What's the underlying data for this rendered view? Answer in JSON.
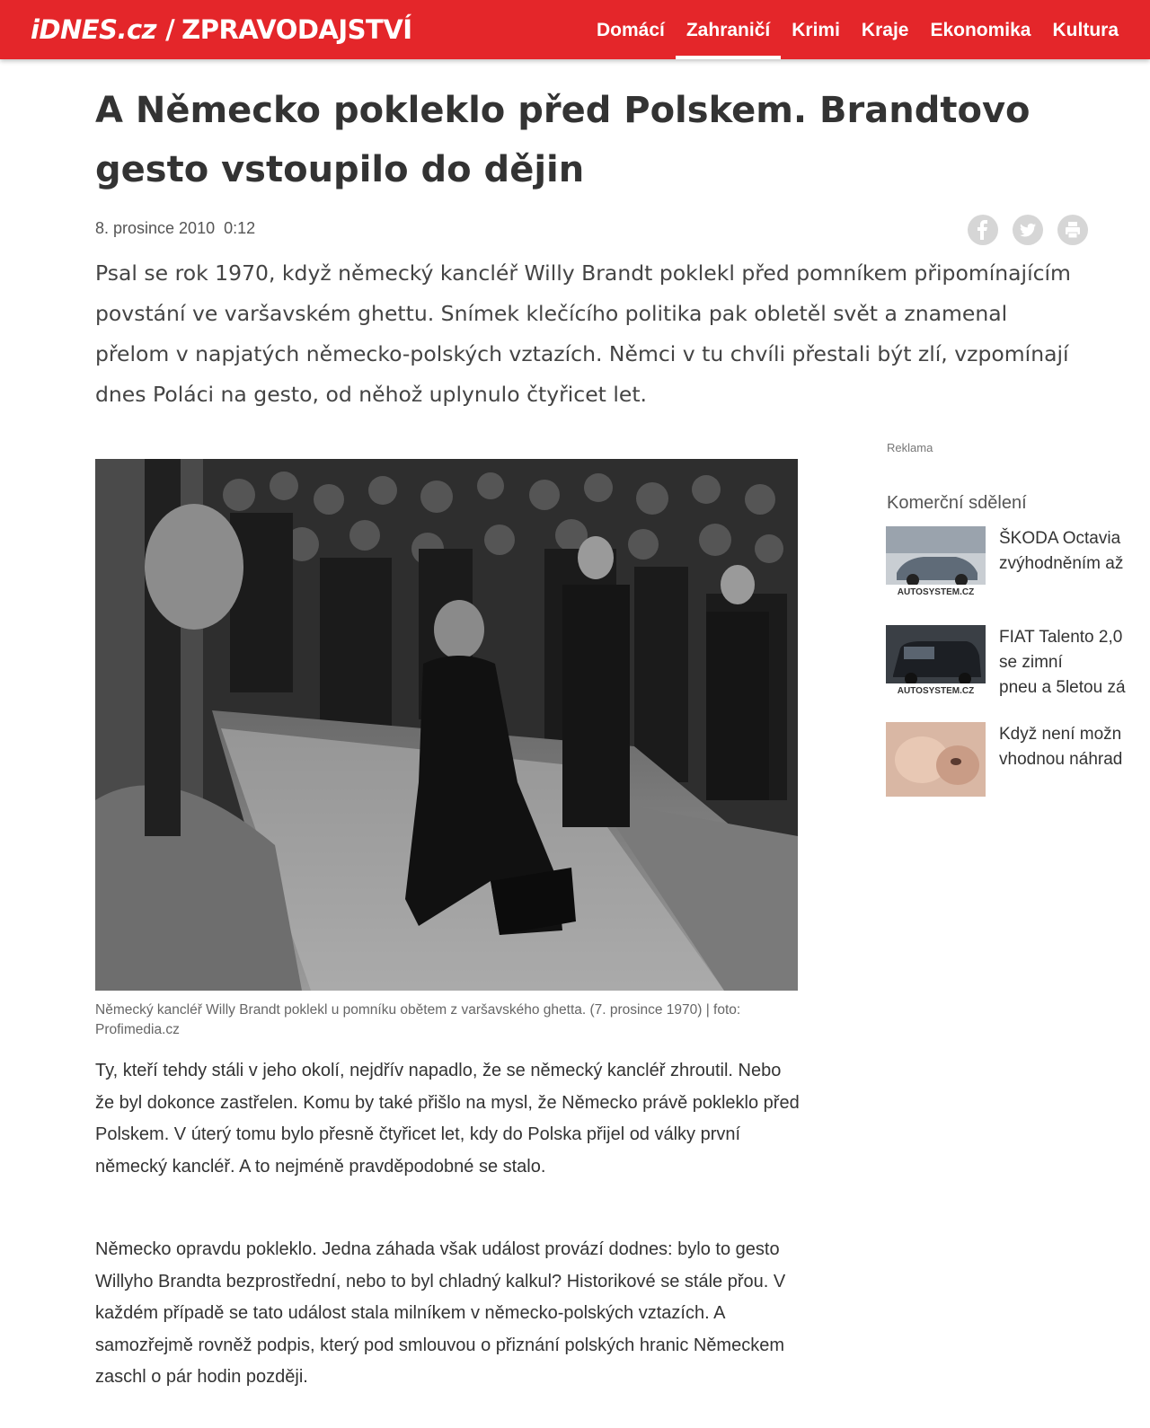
{
  "header": {
    "logo_brand": "iDNES.cz",
    "logo_separator": "/",
    "logo_section": "ZPRAVODAJSTVÍ",
    "nav": [
      {
        "label": "Domácí"
      },
      {
        "label": "Zahraničí",
        "active": true
      },
      {
        "label": "Krimi"
      },
      {
        "label": "Kraje"
      },
      {
        "label": "Ekonomika"
      },
      {
        "label": "Kultura"
      }
    ],
    "brand_color": "#e4262a"
  },
  "article": {
    "title": "A Německo pokleklo před Polskem. Brandtovo gesto vstoupilo do dějin",
    "date": "8. prosince 2010  0:12",
    "share_icons": [
      "facebook-icon",
      "twitter-icon",
      "print-icon"
    ],
    "perex": "Psal se rok 1970, když německý kancléř Willy Brandt poklekl před pomníkem připomínajícím povstání ve varšavském ghettu. Snímek klečícího politika pak obletěl svět a znamenal přelom v napjatých německo-polských vztazích. Němci v tu chvíli přestali být zlí, vzpomínají dnes Poláci na gesto, od něhož uplynulo čtyřicet let.",
    "photo_caption": "Německý kancléř Willy Brandt poklekl u pomníku obětem z varšavského ghetta. (7. prosince 1970) | foto: Profimedia.cz",
    "paragraphs": [
      "Ty, kteří tehdy stáli v jeho okolí, nejdřív napadlo, že se německý kancléř zhroutil. Nebo že byl dokonce zastřelen. Komu by také přišlo na mysl, že Německo právě pokleklo před Polskem. V úterý tomu bylo přesně čtyřicet let, kdy do Polska přijel od války první německý kancléř. A to nejméně pravděpodobné se stalo.",
      "Německo opravdu pokleklo. Jedna záhada však událost provází dodnes: bylo to gesto Willyho Brandta bezprostřední, nebo to byl chladný kalkul? Historikové se stále přou. V každém případě se tato událost stala milníkem v německo-polských vztazích. A samozřejmě rovněž podpis, který pod smlouvou o přiznání polských hranic Německem zaschl o pár hodin později."
    ]
  },
  "sidebar": {
    "ad_label": "Reklama",
    "commercial_title": "Komerční sdělení",
    "items": [
      {
        "text": "ŠKODA Octavia\nzvýhodněním až",
        "thumb_label": "AUTOSYSTEM.CZ"
      },
      {
        "text": "FIAT Talento 2,0\nse zimní\npneu a 5letou zá",
        "thumb_label": "AUTOSYSTEM.CZ"
      },
      {
        "text": "Když není možn\nvhodnou náhrad",
        "thumb_label": ""
      }
    ]
  }
}
